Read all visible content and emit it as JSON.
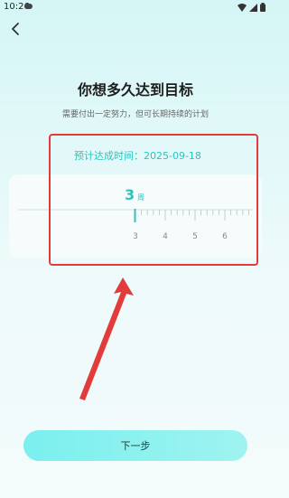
{
  "status_bar": {
    "time": "10:26"
  },
  "header": {
    "title": "你想多久达到目标",
    "subtitle": "需要付出一定努力，但可长期持续的计划"
  },
  "estimate": {
    "text": "预计达成时间：2025-09-18"
  },
  "picker": {
    "value": "3",
    "unit": "周",
    "tick_labels": [
      "3",
      "4",
      "5",
      "6"
    ]
  },
  "footer": {
    "next_label": "下一步"
  },
  "colors": {
    "accent": "#29c5c0",
    "highlight": "#e23b3b",
    "button": "#8ef2ef"
  }
}
